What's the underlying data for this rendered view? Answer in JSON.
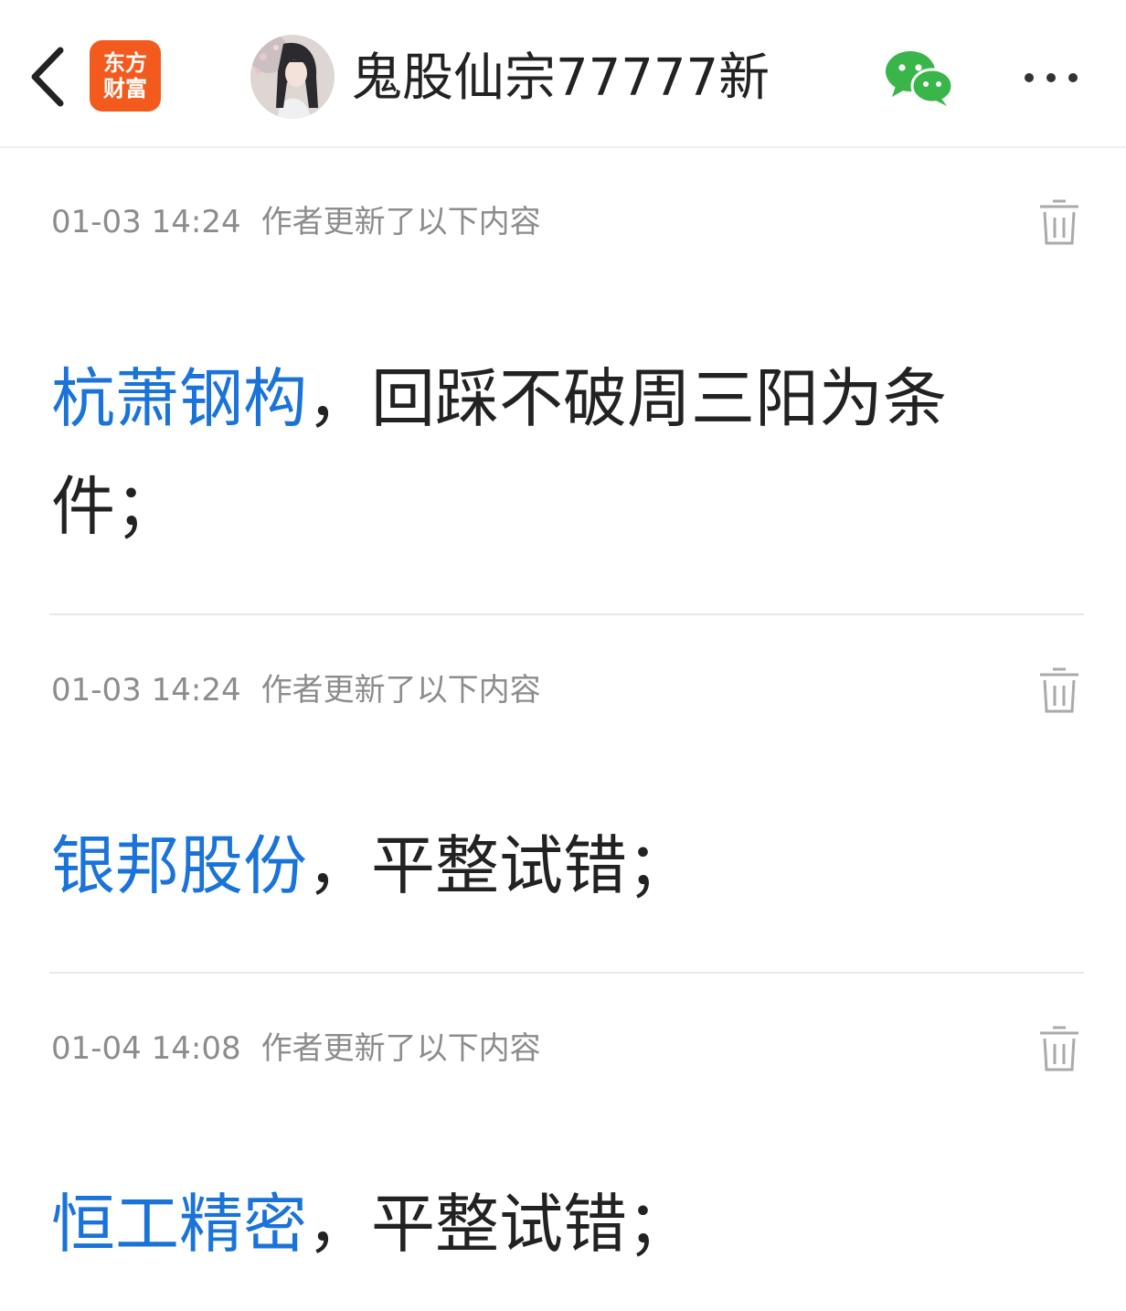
{
  "header": {
    "back_icon": "chevron-left-icon",
    "app_logo_line1": "东方",
    "app_logo_line2": "财富",
    "app_logo_color": "#f25a1e",
    "author_name": "鬼股仙宗77777新",
    "share_icon": "wechat-icon",
    "more_icon": "more-dots-icon"
  },
  "entries": [
    {
      "time": "01-03 14:24",
      "label": "作者更新了以下内容",
      "stock": "杭萧钢构",
      "text": "，回踩不破周三阳为条件；"
    },
    {
      "time": "01-03 14:24",
      "label": "作者更新了以下内容",
      "stock": "银邦股份",
      "text": "，平整试错；"
    },
    {
      "time": "01-04 14:08",
      "label": "作者更新了以下内容",
      "stock": "恒工精密",
      "text": "，平整试错；"
    }
  ],
  "colors": {
    "stock_link": "#1a73d9",
    "meta_text": "#8c8c8c",
    "wechat_green": "#39b54a"
  }
}
